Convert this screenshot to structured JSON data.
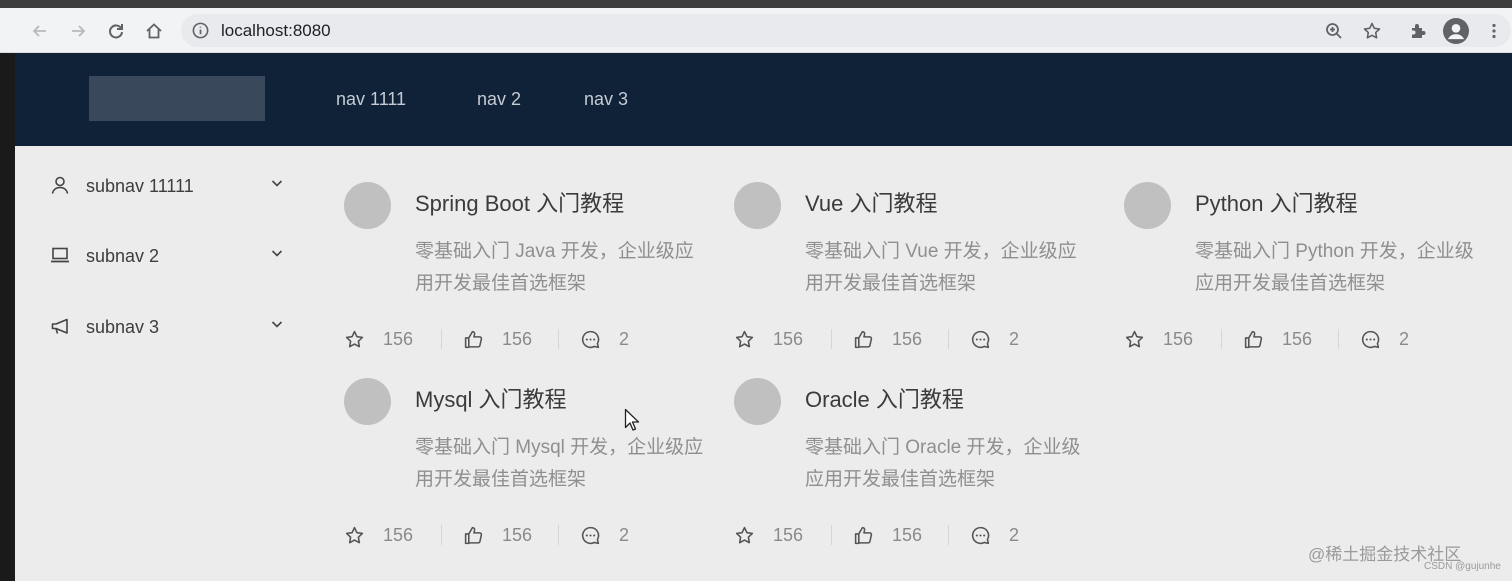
{
  "browser": {
    "url": "localhost:8080",
    "icons": [
      "back-arrow-icon",
      "forward-arrow-icon",
      "reload-icon",
      "home-icon",
      "info-icon",
      "zoom-icon",
      "star-icon",
      "extensions-icon",
      "profile-icon",
      "more-icon"
    ]
  },
  "header": {
    "nav": [
      "nav 1111",
      "nav 2",
      "nav 3"
    ]
  },
  "sidebar": {
    "items": [
      {
        "label": "subnav 11111",
        "icon": "user-icon"
      },
      {
        "label": "subnav 2",
        "icon": "laptop-icon"
      },
      {
        "label": "subnav 3",
        "icon": "notification-icon"
      }
    ]
  },
  "cards": [
    {
      "title": "Spring Boot 入门教程",
      "desc": "零基础入门 Java 开发，企业级应用开发最佳首选框架",
      "stars": "156",
      "likes": "156",
      "comments": "2"
    },
    {
      "title": "Vue 入门教程",
      "desc": "零基础入门 Vue 开发，企业级应用开发最佳首选框架",
      "stars": "156",
      "likes": "156",
      "comments": "2"
    },
    {
      "title": "Python 入门教程",
      "desc": "零基础入门 Python 开发，企业级应用开发最佳首选框架",
      "stars": "156",
      "likes": "156",
      "comments": "2"
    },
    {
      "title": "Mysql 入门教程",
      "desc": "零基础入门 Mysql 开发，企业级应用开发最佳首选框架",
      "stars": "156",
      "likes": "156",
      "comments": "2"
    },
    {
      "title": "Oracle 入门教程",
      "desc": "零基础入门 Oracle 开发，企业级应用开发最佳首选框架",
      "stars": "156",
      "likes": "156",
      "comments": "2"
    }
  ],
  "watermark": {
    "main": "@稀土掘金技术社区",
    "sub": "CSDN @gujunhe"
  },
  "colors": {
    "header_bg": "#0f2238",
    "page_bg": "#ececec",
    "avatar": "#c0c0c0"
  }
}
